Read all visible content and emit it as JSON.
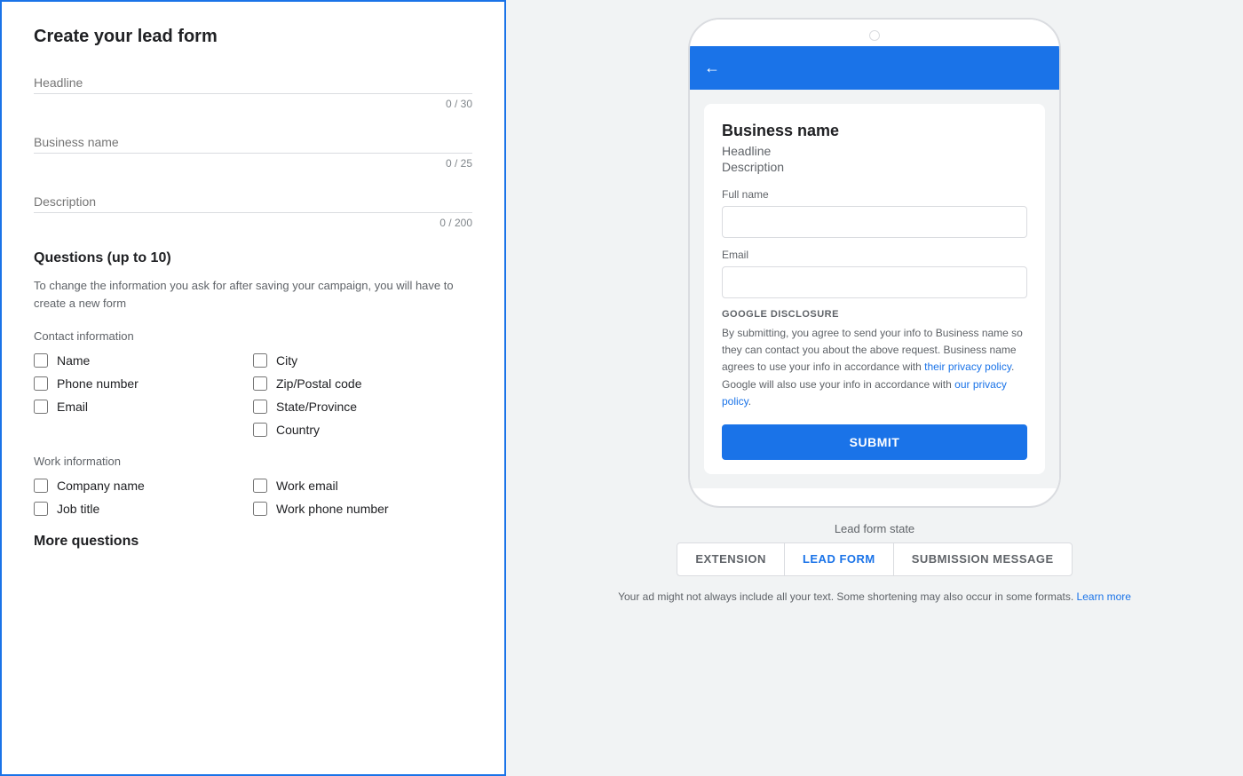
{
  "left": {
    "title": "Create your lead form",
    "headline_label": "Headline",
    "headline_char_count": "0 / 30",
    "business_name_label": "Business name",
    "business_name_char_count": "0 / 25",
    "description_label": "Description",
    "description_char_count": "0 / 200",
    "questions_title": "Questions (up to 10)",
    "questions_desc": "To change the information you ask for after saving your campaign, you will have to create a new form",
    "contact_section_label": "Contact information",
    "contact_checkboxes_col1": [
      "Name",
      "Phone number",
      "Email"
    ],
    "contact_checkboxes_col2": [
      "City",
      "Zip/Postal code",
      "State/Province",
      "Country"
    ],
    "work_section_label": "Work information",
    "work_checkboxes_col1": [
      "Company name",
      "Job title"
    ],
    "work_checkboxes_col2": [
      "Work email",
      "Work phone number"
    ],
    "more_questions_title": "More questions"
  },
  "right": {
    "phone_preview": {
      "business_name": "Business name",
      "headline": "Headline",
      "description": "Description",
      "field1_label": "Full name",
      "field2_label": "Email",
      "disclosure_title": "GOOGLE DISCLOSURE",
      "disclosure_text1": "By submitting, you agree to send your info to Business name so they can contact you about the above request. Business name agrees to use your info in accordance with ",
      "disclosure_link1": "their privacy policy",
      "disclosure_text2": ". Google will also use your info in accordance with ",
      "disclosure_link2": "our privacy policy",
      "disclosure_text3": ".",
      "submit_label": "SUBMIT"
    },
    "lead_form_state_label": "Lead form state",
    "tabs": [
      {
        "label": "EXTENSION",
        "active": false
      },
      {
        "label": "LEAD FORM",
        "active": true
      },
      {
        "label": "SUBMISSION MESSAGE",
        "active": false
      }
    ],
    "disclaimer_text": "Your ad might not always include all your text. Some shortening may also occur in some formats.",
    "learn_more_label": "Learn more"
  }
}
